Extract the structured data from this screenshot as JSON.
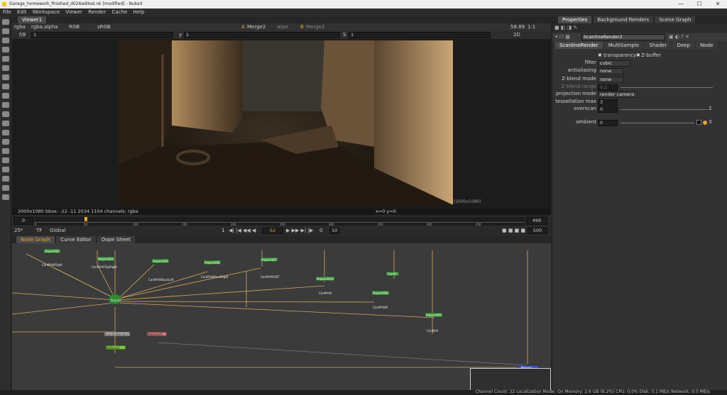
{
  "window": {
    "title": "Garage_homework_finished_d026edited.nk [modified] - NukeX",
    "min": "—",
    "max": "☐",
    "close": "✕"
  },
  "menu": [
    "File",
    "Edit",
    "Workspace",
    "Viewer",
    "Render",
    "Cache",
    "Help"
  ],
  "viewer": {
    "tab": "Viewer1",
    "channels": "rgba",
    "alpha": "rgba.alpha",
    "colorspace_disp": "RGB",
    "lut": "sRGB",
    "gain_label": "f/8",
    "gain_value": "1",
    "gamma_label": "y",
    "gamma_value": "1",
    "input_a": "A",
    "input_a_node": "Merge2",
    "wipe": "wipe",
    "input_b": "B",
    "input_b_node": "Merge2",
    "fps": "58.89",
    "zoom": "1:1",
    "view_mode": "2D",
    "s_label": "S",
    "s_value": "1",
    "format_label": "(2000x1080)",
    "info": "2000x1080  bbox: -22 -11 2034 1104 channels: rgba",
    "coords": "x=0 y=0"
  },
  "timeline": {
    "start": "0",
    "end": "499",
    "ticks": [
      "0",
      "50",
      "100",
      "150",
      "200",
      "250",
      "300",
      "350",
      "400",
      "450"
    ],
    "fps": "25*",
    "tf": "TF",
    "scope": "Global",
    "frame": "52",
    "step_a": "1",
    "step_b": "0",
    "step_c": "10",
    "end_frame": "500"
  },
  "panels": {
    "node_graph": "Node Graph",
    "curve_editor": "Curve Editor",
    "dope_sheet": "Dope Sheet"
  },
  "nodes": [
    {
      "label": "Project3D3"
    },
    {
      "label": "CardPrAllRight"
    },
    {
      "label": "Project3D4"
    },
    {
      "label": "CardPrAllTopRight"
    },
    {
      "label": "Project3D5"
    },
    {
      "label": "CardPrAllBackLeft"
    },
    {
      "label": "Project3D6"
    },
    {
      "label": "CardPrAllBackRight"
    },
    {
      "label": "Project3D7"
    },
    {
      "label": "CardPrAllGRT"
    },
    {
      "label": "Project3D10"
    },
    {
      "label": "CardPrAll"
    },
    {
      "label": "Card4"
    },
    {
      "label": "Project3D8"
    },
    {
      "label": "CardPrAllB"
    },
    {
      "label": "Project3D9"
    },
    {
      "label": "CardPrA"
    },
    {
      "label": "Scene2"
    },
    {
      "label": "ScanlineRender2"
    },
    {
      "label": "Reformat1"
    },
    {
      "label": "Defocus1"
    },
    {
      "label": "Merge2"
    }
  ],
  "properties": {
    "tabs": [
      "Properties",
      "Background Renders",
      "Scene Graph"
    ],
    "node_name": "ScanlineRender2",
    "subtabs": [
      "ScanlineRender",
      "MultiSample",
      "Shader",
      "Deep",
      "Node"
    ],
    "transparency": "transparency",
    "zbuffer": "Z-buffer",
    "rows": [
      {
        "label": "filter",
        "value": "cubic"
      },
      {
        "label": "antialiasing",
        "value": "none"
      },
      {
        "label": "Z-blend mode",
        "value": "none"
      },
      {
        "label": "Z-blend range",
        "value": "0.1"
      },
      {
        "label": "projection mode",
        "value": "render camera"
      },
      {
        "label": "tessellation max",
        "value": "3"
      },
      {
        "label": "overscan",
        "value": "0"
      },
      {
        "label": "ambient",
        "value": "0"
      }
    ],
    "overscan_max": "2",
    "ambient_max": "3"
  },
  "status": "Channel Count: 22  Localization Mode: On  Memory: 2.6 GB (8.2%)  CPU: 0.0%  Disk: 0.1 MB/s  Network: 0.0 MB/s"
}
